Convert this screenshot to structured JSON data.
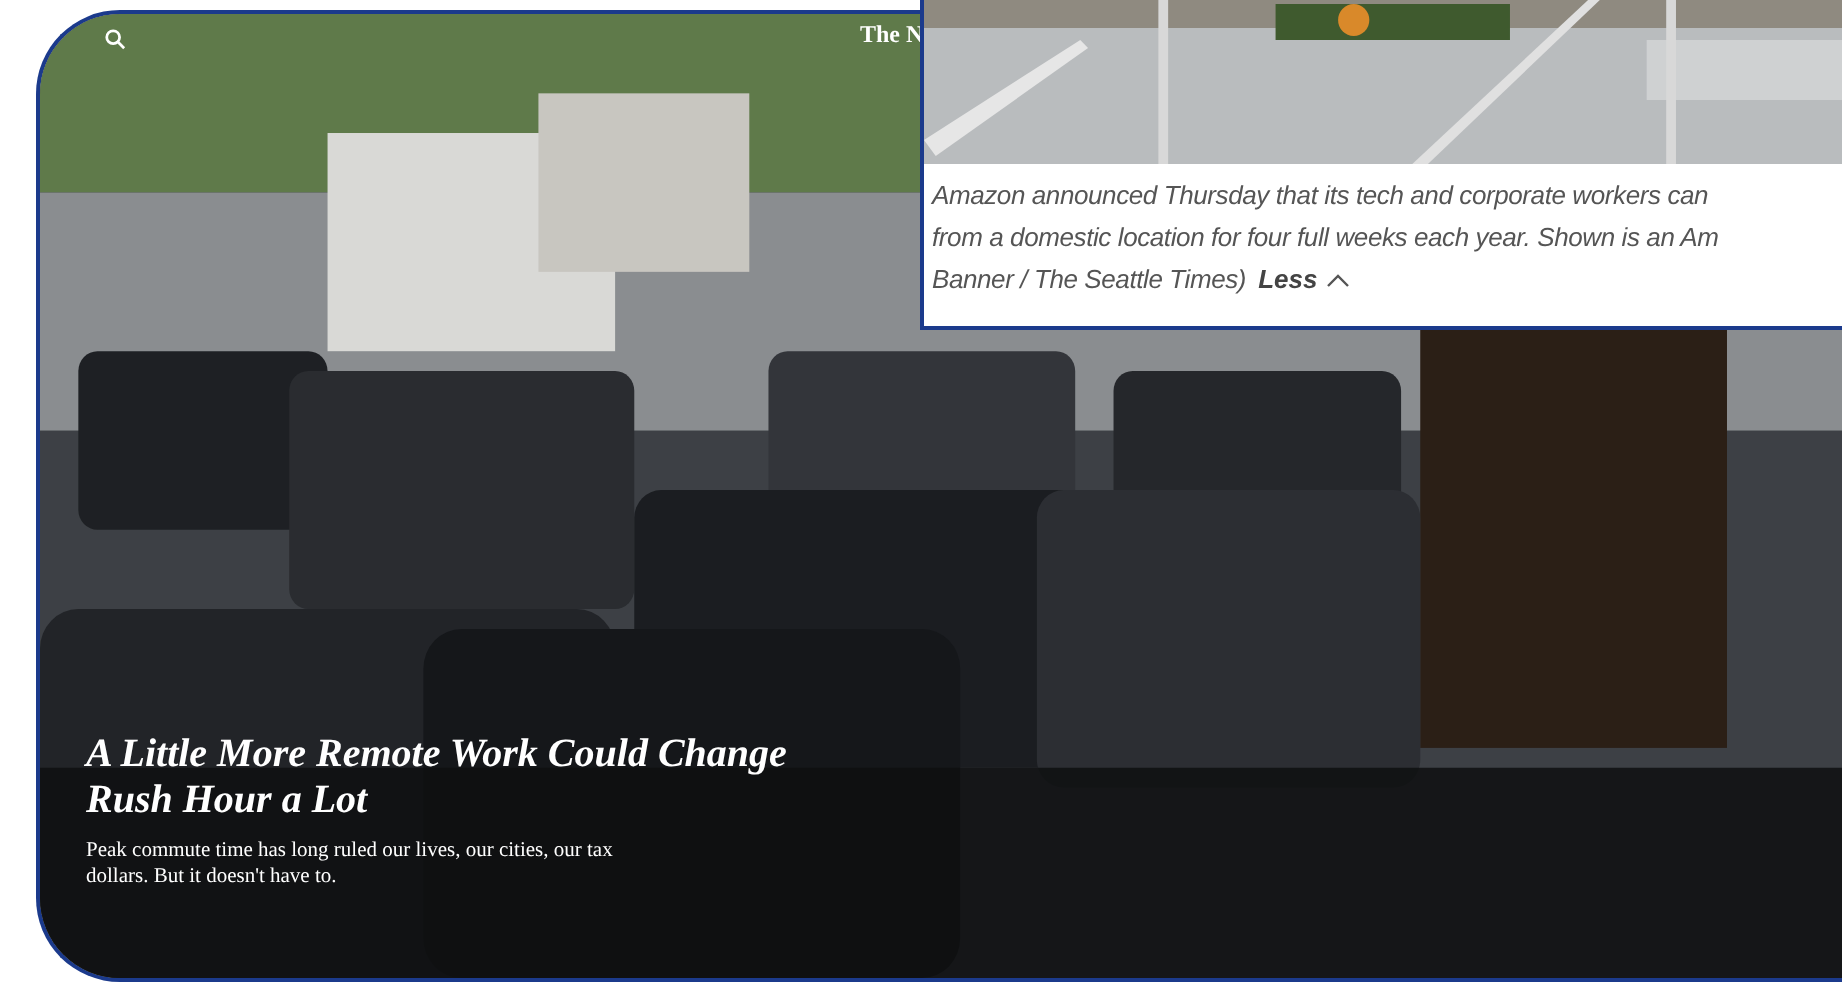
{
  "story": {
    "logo": "The N",
    "headline": "A Little More Remote Work Could Change Rush Hour a Lot",
    "summary": "Peak commute time has long ruled our lives, our cities, our tax dollars. But it doesn't have to."
  },
  "photo_caption": {
    "lines": [
      "Amazon announced Thursday that its tech and corporate workers can",
      "from a domestic location for four full weeks each year. Shown is an Am",
      "Banner / The Seattle Times)"
    ],
    "toggle": "Less"
  }
}
